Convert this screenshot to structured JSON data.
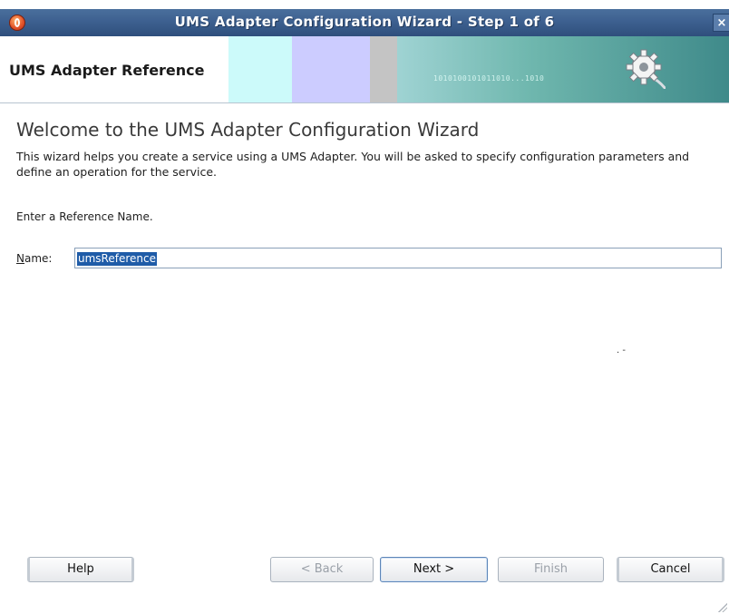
{
  "window": {
    "title": "UMS Adapter Configuration Wizard - Step 1 of 6",
    "close_glyph": "×"
  },
  "banner": {
    "heading": "UMS Adapter Reference",
    "binary_text": "1010100101011010...1010",
    "icon": "gear-plug-icon"
  },
  "content": {
    "welcome": "Welcome to the UMS Adapter Configuration Wizard",
    "description": "This wizard helps you create a service using a UMS Adapter. You will be asked to specify configuration parameters and define an operation for the service.",
    "instruction": "Enter a Reference Name.",
    "name_label_mnemonic": "N",
    "name_label_rest": "ame:",
    "name_value": "umsReference"
  },
  "buttons": {
    "help": "Help",
    "back": "< Back",
    "next": "Next >",
    "finish": "Finish",
    "cancel": "Cancel"
  },
  "colors": {
    "titlebar": "#3d6090",
    "selection": "#1f5ca8"
  }
}
